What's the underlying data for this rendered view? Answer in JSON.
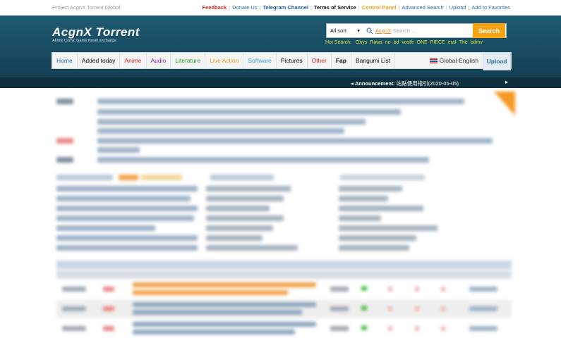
{
  "top": {
    "site_name": "Project AcgnX Torrent Global",
    "links": [
      {
        "label": "Feedback",
        "color": "#d62728"
      },
      {
        "label": "Donate Us",
        "color": "#2a6fa8"
      },
      {
        "label": "Telegram Channel",
        "color": "#1f5fb0"
      },
      {
        "label": "Terms of Service",
        "color": "#111111"
      },
      {
        "label": "Control Panel",
        "color": "#f0a020"
      },
      {
        "label": "Advanced Search",
        "color": "#2a6fa8"
      },
      {
        "label": "Upload",
        "color": "#2a6fa8"
      },
      {
        "label": "Add to Favorites",
        "color": "#2a6fa8"
      }
    ]
  },
  "header": {
    "logo": "AcgnX Torrent",
    "tagline": "Anime Comic Game Novel eXchange"
  },
  "search": {
    "sort_value": "All sort",
    "engine_label": "AcgnX",
    "placeholder": "Search ...",
    "button_label": "Search",
    "hot_label": "Hot Search:",
    "hot_terms": [
      "Ohys",
      "Raws",
      "no",
      "bd",
      "vostfr",
      "ONE",
      "PIECE",
      "eraI",
      "The",
      "bdmv"
    ]
  },
  "nav": {
    "items": [
      {
        "label": "Home",
        "color": "#2a6fa8"
      },
      {
        "label": "Added today",
        "color": "#111111"
      },
      {
        "label": "Anime",
        "color": "#d62728"
      },
      {
        "label": "Audio",
        "color": "#8e2ba8"
      },
      {
        "label": "Literature",
        "color": "#2e9e3a"
      },
      {
        "label": "Live Action",
        "color": "#f0a020"
      },
      {
        "label": "Software",
        "color": "#3aa0d8"
      },
      {
        "label": "Pictures",
        "color": "#111111"
      },
      {
        "label": "Other",
        "color": "#d62728"
      },
      {
        "label": "Fap",
        "color": "#111111"
      },
      {
        "label": "Bangumi List",
        "color": "#111111"
      }
    ],
    "language": "Global-English",
    "upload": "Upload"
  },
  "announcement": {
    "label": "Announcement",
    "text": "站點使用指引(2020-05-05)"
  }
}
